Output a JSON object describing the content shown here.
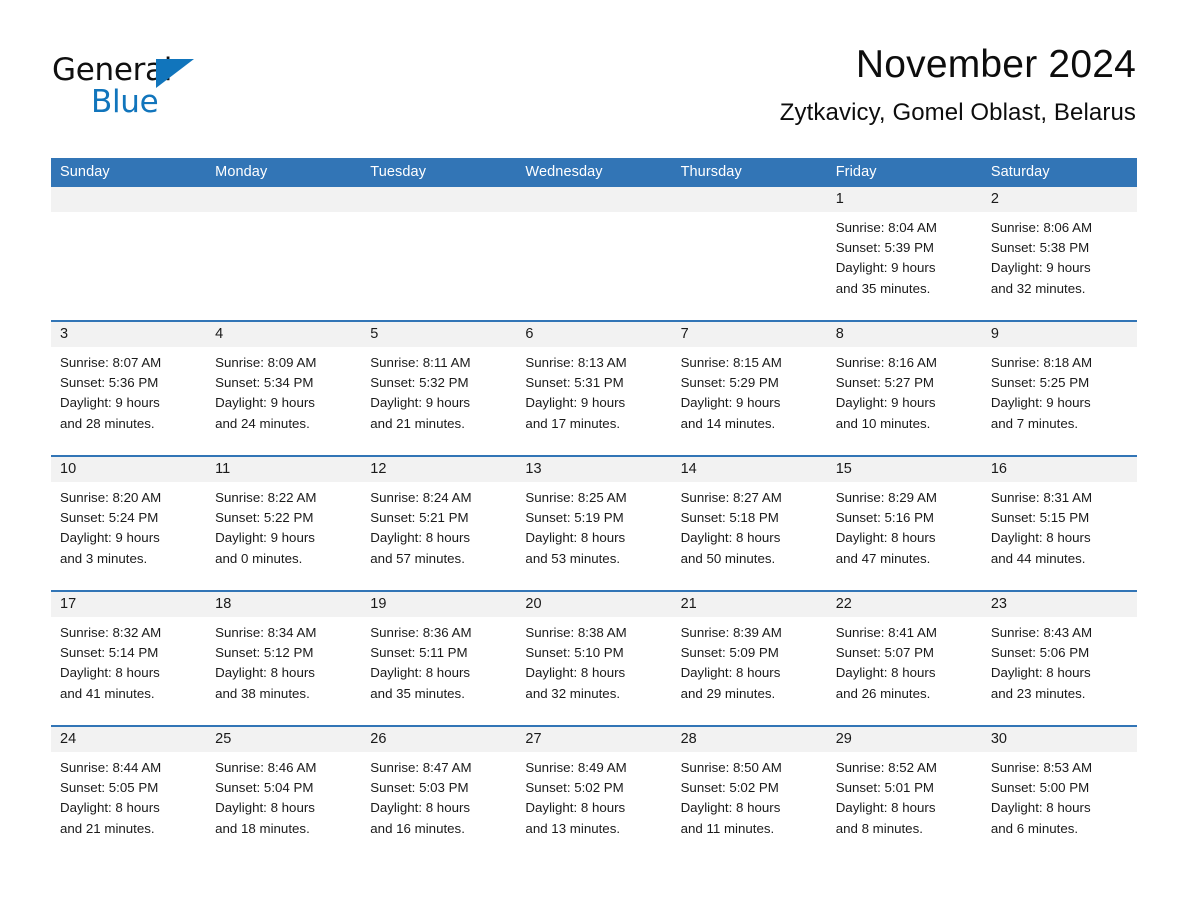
{
  "logo": {
    "word_dark": "General",
    "word_blue": "Blue",
    "triangle_color": "#1175bc"
  },
  "header": {
    "month_title": "November 2024",
    "location": "Zytkavicy, Gomel Oblast, Belarus"
  },
  "theme": {
    "header_blue": "#3275b6",
    "daynum_band": "#f2f2f2",
    "text": "#1a1a1a",
    "page_background": "#ffffff"
  },
  "calendar": {
    "weekday_headers": [
      "Sunday",
      "Monday",
      "Tuesday",
      "Wednesday",
      "Thursday",
      "Friday",
      "Saturday"
    ],
    "weeks": [
      [
        {
          "day": "",
          "details": ""
        },
        {
          "day": "",
          "details": ""
        },
        {
          "day": "",
          "details": ""
        },
        {
          "day": "",
          "details": ""
        },
        {
          "day": "",
          "details": ""
        },
        {
          "day": "1",
          "details": "Sunrise: 8:04 AM\nSunset: 5:39 PM\nDaylight: 9 hours\nand 35 minutes."
        },
        {
          "day": "2",
          "details": "Sunrise: 8:06 AM\nSunset: 5:38 PM\nDaylight: 9 hours\nand 32 minutes."
        }
      ],
      [
        {
          "day": "3",
          "details": "Sunrise: 8:07 AM\nSunset: 5:36 PM\nDaylight: 9 hours\nand 28 minutes."
        },
        {
          "day": "4",
          "details": "Sunrise: 8:09 AM\nSunset: 5:34 PM\nDaylight: 9 hours\nand 24 minutes."
        },
        {
          "day": "5",
          "details": "Sunrise: 8:11 AM\nSunset: 5:32 PM\nDaylight: 9 hours\nand 21 minutes."
        },
        {
          "day": "6",
          "details": "Sunrise: 8:13 AM\nSunset: 5:31 PM\nDaylight: 9 hours\nand 17 minutes."
        },
        {
          "day": "7",
          "details": "Sunrise: 8:15 AM\nSunset: 5:29 PM\nDaylight: 9 hours\nand 14 minutes."
        },
        {
          "day": "8",
          "details": "Sunrise: 8:16 AM\nSunset: 5:27 PM\nDaylight: 9 hours\nand 10 minutes."
        },
        {
          "day": "9",
          "details": "Sunrise: 8:18 AM\nSunset: 5:25 PM\nDaylight: 9 hours\nand 7 minutes."
        }
      ],
      [
        {
          "day": "10",
          "details": "Sunrise: 8:20 AM\nSunset: 5:24 PM\nDaylight: 9 hours\nand 3 minutes."
        },
        {
          "day": "11",
          "details": "Sunrise: 8:22 AM\nSunset: 5:22 PM\nDaylight: 9 hours\nand 0 minutes."
        },
        {
          "day": "12",
          "details": "Sunrise: 8:24 AM\nSunset: 5:21 PM\nDaylight: 8 hours\nand 57 minutes."
        },
        {
          "day": "13",
          "details": "Sunrise: 8:25 AM\nSunset: 5:19 PM\nDaylight: 8 hours\nand 53 minutes."
        },
        {
          "day": "14",
          "details": "Sunrise: 8:27 AM\nSunset: 5:18 PM\nDaylight: 8 hours\nand 50 minutes."
        },
        {
          "day": "15",
          "details": "Sunrise: 8:29 AM\nSunset: 5:16 PM\nDaylight: 8 hours\nand 47 minutes."
        },
        {
          "day": "16",
          "details": "Sunrise: 8:31 AM\nSunset: 5:15 PM\nDaylight: 8 hours\nand 44 minutes."
        }
      ],
      [
        {
          "day": "17",
          "details": "Sunrise: 8:32 AM\nSunset: 5:14 PM\nDaylight: 8 hours\nand 41 minutes."
        },
        {
          "day": "18",
          "details": "Sunrise: 8:34 AM\nSunset: 5:12 PM\nDaylight: 8 hours\nand 38 minutes."
        },
        {
          "day": "19",
          "details": "Sunrise: 8:36 AM\nSunset: 5:11 PM\nDaylight: 8 hours\nand 35 minutes."
        },
        {
          "day": "20",
          "details": "Sunrise: 8:38 AM\nSunset: 5:10 PM\nDaylight: 8 hours\nand 32 minutes."
        },
        {
          "day": "21",
          "details": "Sunrise: 8:39 AM\nSunset: 5:09 PM\nDaylight: 8 hours\nand 29 minutes."
        },
        {
          "day": "22",
          "details": "Sunrise: 8:41 AM\nSunset: 5:07 PM\nDaylight: 8 hours\nand 26 minutes."
        },
        {
          "day": "23",
          "details": "Sunrise: 8:43 AM\nSunset: 5:06 PM\nDaylight: 8 hours\nand 23 minutes."
        }
      ],
      [
        {
          "day": "24",
          "details": "Sunrise: 8:44 AM\nSunset: 5:05 PM\nDaylight: 8 hours\nand 21 minutes."
        },
        {
          "day": "25",
          "details": "Sunrise: 8:46 AM\nSunset: 5:04 PM\nDaylight: 8 hours\nand 18 minutes."
        },
        {
          "day": "26",
          "details": "Sunrise: 8:47 AM\nSunset: 5:03 PM\nDaylight: 8 hours\nand 16 minutes."
        },
        {
          "day": "27",
          "details": "Sunrise: 8:49 AM\nSunset: 5:02 PM\nDaylight: 8 hours\nand 13 minutes."
        },
        {
          "day": "28",
          "details": "Sunrise: 8:50 AM\nSunset: 5:02 PM\nDaylight: 8 hours\nand 11 minutes."
        },
        {
          "day": "29",
          "details": "Sunrise: 8:52 AM\nSunset: 5:01 PM\nDaylight: 8 hours\nand 8 minutes."
        },
        {
          "day": "30",
          "details": "Sunrise: 8:53 AM\nSunset: 5:00 PM\nDaylight: 8 hours\nand 6 minutes."
        }
      ]
    ]
  }
}
